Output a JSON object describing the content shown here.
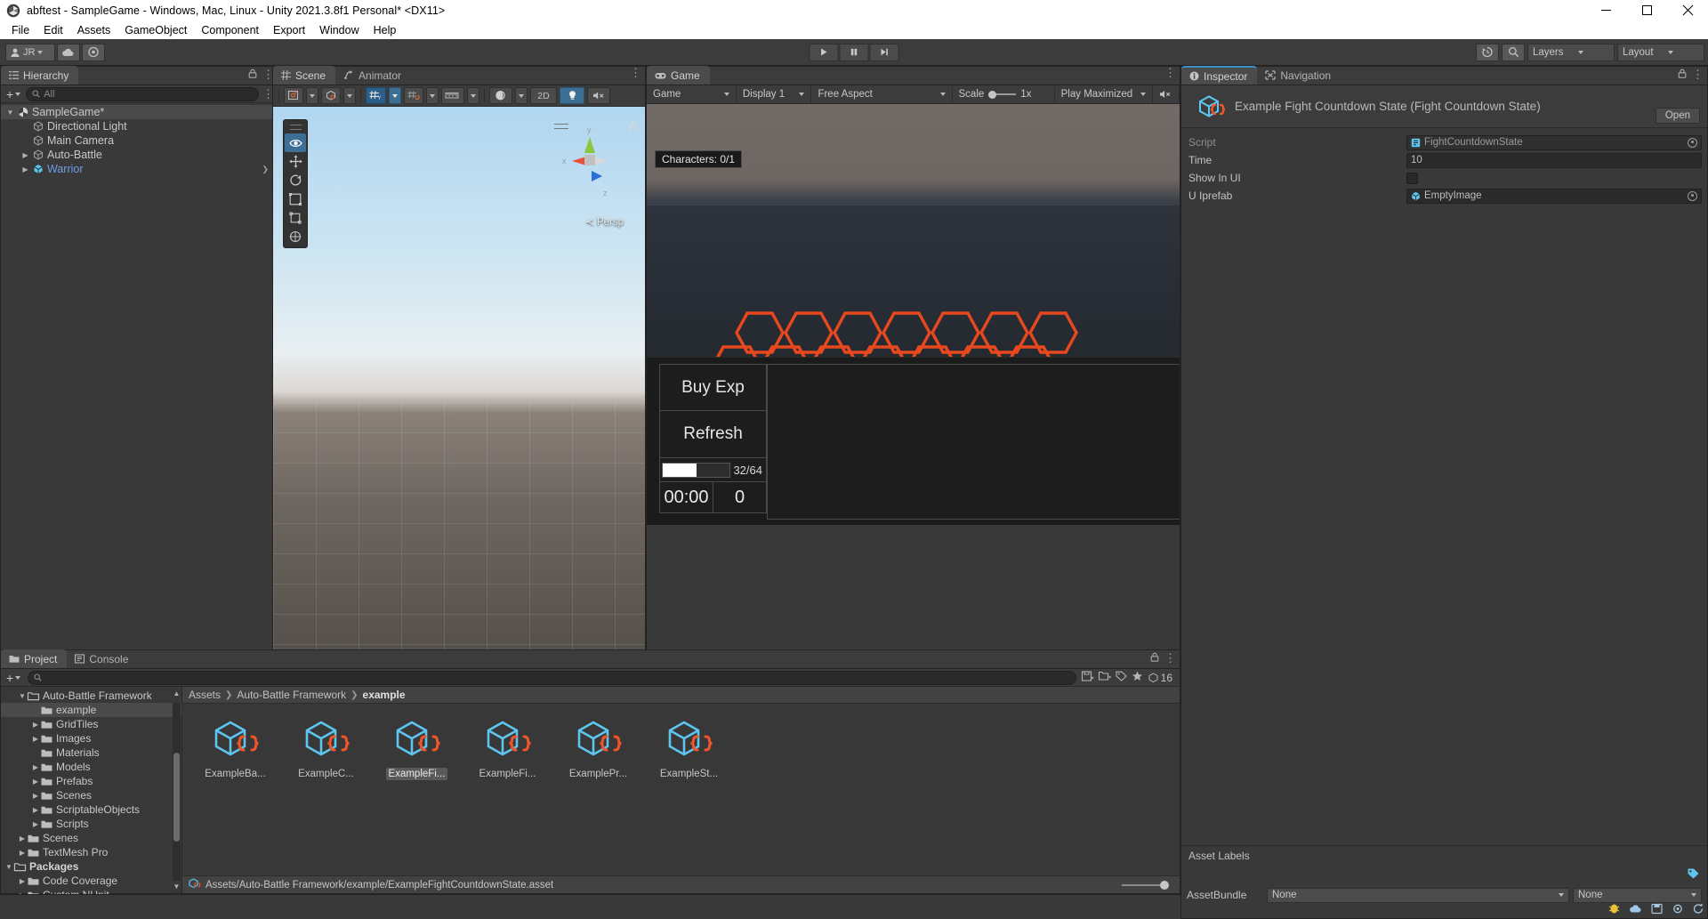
{
  "window": {
    "title": "abftest - SampleGame - Windows, Mac, Linux - Unity 2021.3.8f1 Personal* <DX11>",
    "minimize": "minimize-icon",
    "maximize": "maximize-icon",
    "close": "close-icon"
  },
  "menu": {
    "items": [
      "File",
      "Edit",
      "Assets",
      "GameObject",
      "Component",
      "Export",
      "Window",
      "Help"
    ]
  },
  "toolbar": {
    "account": "JR",
    "cloud_icon": "cloud-icon",
    "collab_icon": "collab-icon",
    "play": "play-icon",
    "pause": "pause-icon",
    "step": "step-icon",
    "undo_history": "history-icon",
    "search": "search-icon",
    "layers": "Layers",
    "layout": "Layout"
  },
  "hierarchy": {
    "tab": "Hierarchy",
    "tab_icon": "hierarchy-icon",
    "add_label": "+",
    "search_placeholder": "All",
    "items": [
      {
        "label": "SampleGame*",
        "depth": 0,
        "twisty": "▼",
        "icon": "scene-icon",
        "selected": true,
        "prefab": false,
        "chevron": false
      },
      {
        "label": "Directional Light",
        "depth": 1,
        "twisty": "",
        "icon": "gameobject-icon",
        "selected": false,
        "prefab": false,
        "chevron": false
      },
      {
        "label": "Main Camera",
        "depth": 1,
        "twisty": "",
        "icon": "gameobject-icon",
        "selected": false,
        "prefab": false,
        "chevron": false
      },
      {
        "label": "Auto-Battle",
        "depth": 1,
        "twisty": "▶",
        "icon": "gameobject-icon",
        "selected": false,
        "prefab": false,
        "chevron": false
      },
      {
        "label": "Warrior",
        "depth": 1,
        "twisty": "▶",
        "icon": "prefab-icon",
        "selected": false,
        "prefab": true,
        "chevron": true
      }
    ]
  },
  "scene": {
    "tabs": [
      {
        "label": "Scene",
        "icon": "scene-grid-icon",
        "active": true
      },
      {
        "label": "Animator",
        "icon": "animator-icon",
        "active": false
      }
    ],
    "tools": [
      {
        "name": "draw-mode-dropdown",
        "label": "",
        "icon": "shaded-icon",
        "active": false,
        "dropdown": true
      },
      {
        "name": "2d-gizmo-dropdown",
        "label": "",
        "icon": "gizmo-cube-icon",
        "active": false,
        "dropdown": true
      },
      {
        "name": "grid-snap-toggle",
        "label": "",
        "icon": "grid-y-icon",
        "active": true,
        "dropdown": true
      },
      {
        "name": "snap-increment",
        "label": "",
        "icon": "snap-icon",
        "active": false,
        "dropdown": true
      },
      {
        "name": "grid-size",
        "label": "",
        "icon": "ruler-icon",
        "active": false,
        "dropdown": true
      },
      {
        "name": "scene-lighting",
        "label": "",
        "icon": "sphere-icon",
        "active": false,
        "dropdown": true
      },
      {
        "name": "2d-toggle",
        "label": "2D",
        "icon": "",
        "active": false,
        "dropdown": false
      },
      {
        "name": "lighting-toggle",
        "label": "",
        "icon": "light-bulb-icon",
        "active": true,
        "dropdown": false
      },
      {
        "name": "audio-toggle",
        "label": "",
        "icon": "mute-audio-icon",
        "active": false,
        "dropdown": false
      }
    ],
    "overlay_tools": [
      {
        "name": "view-tool",
        "icon": "eye-icon",
        "active": true
      },
      {
        "name": "move-tool",
        "icon": "move-icon",
        "active": false
      },
      {
        "name": "rotate-tool",
        "icon": "rotate-icon",
        "active": false
      },
      {
        "name": "scale-tool",
        "icon": "scale-icon",
        "active": false
      },
      {
        "name": "rect-tool",
        "icon": "rect-transform-icon",
        "active": false
      },
      {
        "name": "transform-tool",
        "icon": "transform-icon",
        "active": false
      }
    ],
    "perspective_label": "≺ Persp",
    "gizmo_axes": {
      "x": "x",
      "y": "y",
      "z": "z"
    }
  },
  "game": {
    "tab": "Game",
    "tab_icon": "gamepad-icon",
    "controls": [
      {
        "name": "display-target",
        "label": "Game",
        "dropdown": true
      },
      {
        "name": "display-select",
        "label": "Display 1",
        "dropdown": true
      },
      {
        "name": "aspect-select",
        "label": "Free Aspect",
        "dropdown": true
      },
      {
        "name": "scale-slider",
        "label": "Scale",
        "value": "1x",
        "dropdown": false
      },
      {
        "name": "play-maximized",
        "label": "Play Maximized",
        "dropdown": true
      },
      {
        "name": "mute-audio",
        "label": "",
        "icon": "mute-audio-icon",
        "dropdown": false
      }
    ],
    "character_counter": "Characters: 0/1",
    "ui": {
      "buy_exp": "Buy Exp",
      "refresh": "Refresh",
      "exp_bar_value": "32/64",
      "exp_bar_percent": 50,
      "timer": "00:00",
      "counter": "0"
    },
    "colors": {
      "enemy_hex": "#e8481e",
      "player_hex": "#1c4ed8",
      "bench_hex": "#2b5fe0"
    }
  },
  "inspector": {
    "tabs": [
      {
        "label": "Inspector",
        "icon": "info-icon",
        "active": true
      },
      {
        "label": "Navigation",
        "icon": "navigation-icon",
        "active": false
      }
    ],
    "asset_title": "Example Fight Countdown State (Fight Countdown State)",
    "asset_icon": "scriptable-object-icon",
    "open_button": "Open",
    "properties": [
      {
        "label": "Script",
        "value": "FightCountdownState",
        "type": "object",
        "icon": "script-icon",
        "dimmed": true
      },
      {
        "label": "Time",
        "value": "10",
        "type": "text",
        "dimmed": false
      },
      {
        "label": "Show In UI",
        "value": "",
        "type": "checkbox",
        "checked": false,
        "dimmed": false
      },
      {
        "label": "U Iprefab",
        "value": "EmptyImage",
        "type": "object",
        "icon": "prefab-icon",
        "dimmed": false
      }
    ],
    "asset_labels_header": "Asset Labels",
    "label_tag_icon": "tag-icon",
    "assetbundle_label": "AssetBundle",
    "assetbundle_value": "None",
    "assetbundle_variant": "None"
  },
  "project": {
    "tabs": [
      {
        "label": "Project",
        "icon": "folder-icon",
        "active": true
      },
      {
        "label": "Console",
        "icon": "console-icon",
        "active": false
      }
    ],
    "add_label": "+",
    "search_placeholder": "",
    "search_icon": "search-icon",
    "toolbar_icons": [
      "save-filter-icon",
      "new-filter-icon",
      "label-icon",
      "star-icon"
    ],
    "item_count": "16",
    "tree": [
      {
        "label": "Auto-Battle Framework",
        "depth": 1,
        "twisty": "▼",
        "icon": "folder-open-icon",
        "selected": false,
        "bold": false
      },
      {
        "label": "example",
        "depth": 2,
        "twisty": "",
        "icon": "folder-icon",
        "selected": true,
        "bold": false
      },
      {
        "label": "GridTiles",
        "depth": 2,
        "twisty": "▶",
        "icon": "folder-icon",
        "selected": false,
        "bold": false
      },
      {
        "label": "Images",
        "depth": 2,
        "twisty": "▶",
        "icon": "folder-icon",
        "selected": false,
        "bold": false
      },
      {
        "label": "Materials",
        "depth": 2,
        "twisty": "",
        "icon": "folder-icon",
        "selected": false,
        "bold": false
      },
      {
        "label": "Models",
        "depth": 2,
        "twisty": "▶",
        "icon": "folder-icon",
        "selected": false,
        "bold": false
      },
      {
        "label": "Prefabs",
        "depth": 2,
        "twisty": "▶",
        "icon": "folder-icon",
        "selected": false,
        "bold": false
      },
      {
        "label": "Scenes",
        "depth": 2,
        "twisty": "▶",
        "icon": "folder-icon",
        "selected": false,
        "bold": false
      },
      {
        "label": "ScriptableObjects",
        "depth": 2,
        "twisty": "▶",
        "icon": "folder-icon",
        "selected": false,
        "bold": false
      },
      {
        "label": "Scripts",
        "depth": 2,
        "twisty": "▶",
        "icon": "folder-icon",
        "selected": false,
        "bold": false
      },
      {
        "label": "Scenes",
        "depth": 1,
        "twisty": "▶",
        "icon": "folder-icon",
        "selected": false,
        "bold": false
      },
      {
        "label": "TextMesh Pro",
        "depth": 1,
        "twisty": "▶",
        "icon": "folder-icon",
        "selected": false,
        "bold": false
      },
      {
        "label": "Packages",
        "depth": 0,
        "twisty": "▼",
        "icon": "folder-open-icon",
        "selected": false,
        "bold": true
      },
      {
        "label": "Code Coverage",
        "depth": 1,
        "twisty": "▶",
        "icon": "folder-icon",
        "selected": false,
        "bold": false
      },
      {
        "label": "Custom NUnit",
        "depth": 1,
        "twisty": "▶",
        "icon": "folder-icon",
        "selected": false,
        "bold": false
      }
    ],
    "breadcrumb": [
      "Assets",
      "Auto-Battle Framework",
      "example"
    ],
    "assets": [
      {
        "name": "ExampleBa...",
        "icon": "scriptable-object-icon",
        "selected": false
      },
      {
        "name": "ExampleC...",
        "icon": "scriptable-object-icon",
        "selected": false
      },
      {
        "name": "ExampleFi...",
        "icon": "scriptable-object-icon",
        "selected": true
      },
      {
        "name": "ExampleFi...",
        "icon": "scriptable-object-icon",
        "selected": false
      },
      {
        "name": "ExamplePr...",
        "icon": "scriptable-object-icon",
        "selected": false
      },
      {
        "name": "ExampleSt...",
        "icon": "scriptable-object-icon",
        "selected": false
      }
    ],
    "status_path": "Assets/Auto-Battle Framework/example/ExampleFightCountdownState.asset",
    "status_icon": "scriptable-object-icon"
  },
  "statusbar": {
    "icons": [
      "bug-icon",
      "cloud-status-icon",
      "save-status-icon",
      "settings-status-icon",
      "refresh-status-icon"
    ]
  }
}
